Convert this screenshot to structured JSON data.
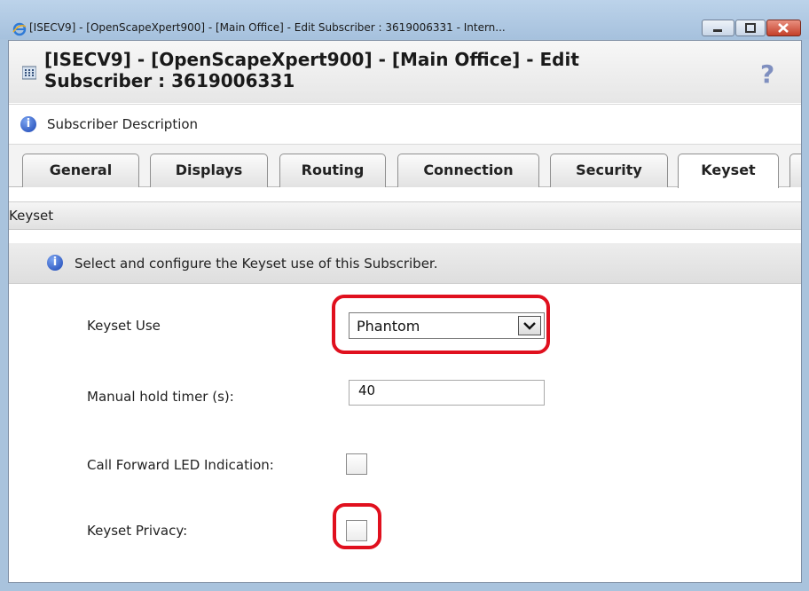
{
  "window": {
    "title": "[ISECV9] - [OpenScapeXpert900] - [Main Office] - Edit Subscriber : 3619006331 - Intern...",
    "minimize_icon": "minimize-icon",
    "maximize_icon": "maximize-icon",
    "close_icon": "close-icon"
  },
  "header": {
    "title": "[ISECV9] - [OpenScapeXpert900] - [Main Office] - Edit Subscriber : 3619006331",
    "help": "?"
  },
  "description": {
    "label": "Subscriber Description"
  },
  "tabs": [
    {
      "label": "General",
      "active": false
    },
    {
      "label": "Displays",
      "active": false
    },
    {
      "label": "Routing",
      "active": false
    },
    {
      "label": "Connection",
      "active": false
    },
    {
      "label": "Security",
      "active": false
    },
    {
      "label": "Keyset",
      "active": true
    }
  ],
  "section": {
    "title": "Keyset",
    "info": "Select and configure the Keyset use of this Subscriber."
  },
  "form": {
    "keyset_use": {
      "label": "Keyset Use",
      "value": "Phantom"
    },
    "manual_hold_timer": {
      "label": "Manual hold timer (s):",
      "value": "40"
    },
    "call_forward_led": {
      "label": "Call Forward LED Indication:",
      "checked": false
    },
    "keyset_privacy": {
      "label": "Keyset Privacy:",
      "checked": false
    }
  },
  "colors": {
    "highlight": "#e0101e",
    "accent": "#1c46b4"
  }
}
